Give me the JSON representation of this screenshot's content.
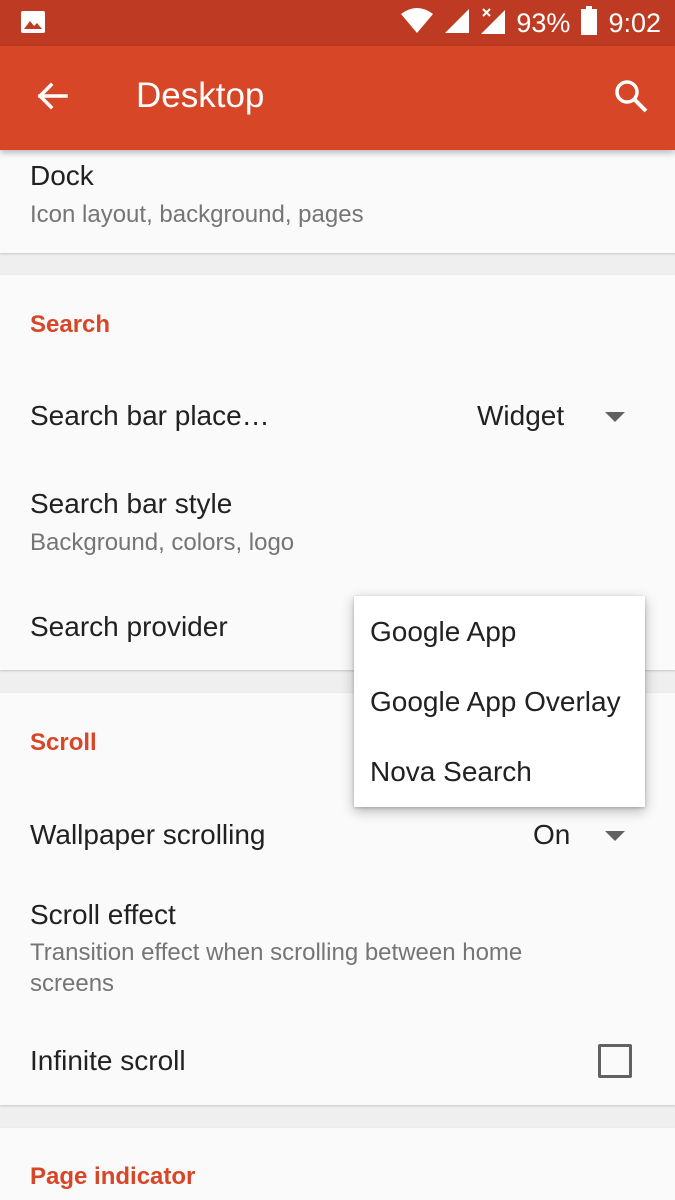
{
  "status_bar": {
    "battery_percent": "93%",
    "time": "9:02",
    "icons": [
      "image-icon",
      "wifi-icon",
      "signal-icon",
      "signal-off-icon",
      "battery-icon"
    ]
  },
  "app_bar": {
    "title": "Desktop",
    "back_icon": "arrow-back-icon",
    "search_icon": "search-icon",
    "color": "#d84628"
  },
  "dock": {
    "title": "Dock",
    "subtitle": "Icon layout, background, pages"
  },
  "search_section": {
    "header": "Search",
    "placement": {
      "label": "Search bar place…",
      "value": "Widget"
    },
    "style": {
      "label": "Search bar style",
      "subtitle": "Background, colors, logo"
    },
    "provider": {
      "label": "Search provider"
    }
  },
  "scroll_section": {
    "header": "Scroll",
    "wallpaper": {
      "label": "Wallpaper scrolling",
      "value": "On"
    },
    "effect": {
      "label": "Scroll effect",
      "subtitle": "Transition effect when scrolling between home screens"
    },
    "infinite": {
      "label": "Infinite scroll",
      "checked": false
    }
  },
  "page_indicator_section": {
    "header": "Page indicator"
  },
  "provider_menu": {
    "options": [
      "Google App",
      "Google App Overlay",
      "Nova Search"
    ]
  },
  "colors": {
    "accent": "#d84628",
    "status_bar": "#bf3a22"
  }
}
